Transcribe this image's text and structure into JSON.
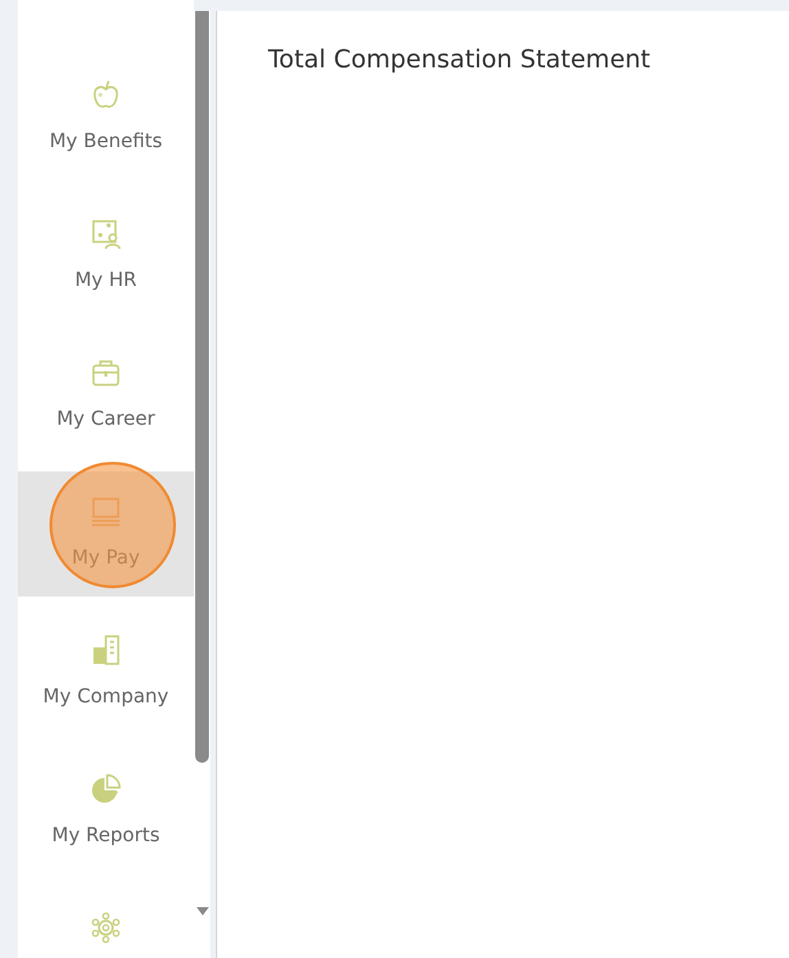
{
  "sidebar": {
    "items": [
      {
        "kind": "benefits",
        "label": "My Benefits",
        "selected": false
      },
      {
        "kind": "hr",
        "label": "My HR",
        "selected": false
      },
      {
        "kind": "career",
        "label": "My Career",
        "selected": false
      },
      {
        "kind": "pay",
        "label": "My Pay",
        "selected": true
      },
      {
        "kind": "company",
        "label": "My Company",
        "selected": false
      },
      {
        "kind": "reports",
        "label": "My Reports",
        "selected": false
      },
      {
        "kind": "settings",
        "selected": false
      }
    ]
  },
  "main": {
    "title": "Total Compensation Statement"
  }
}
